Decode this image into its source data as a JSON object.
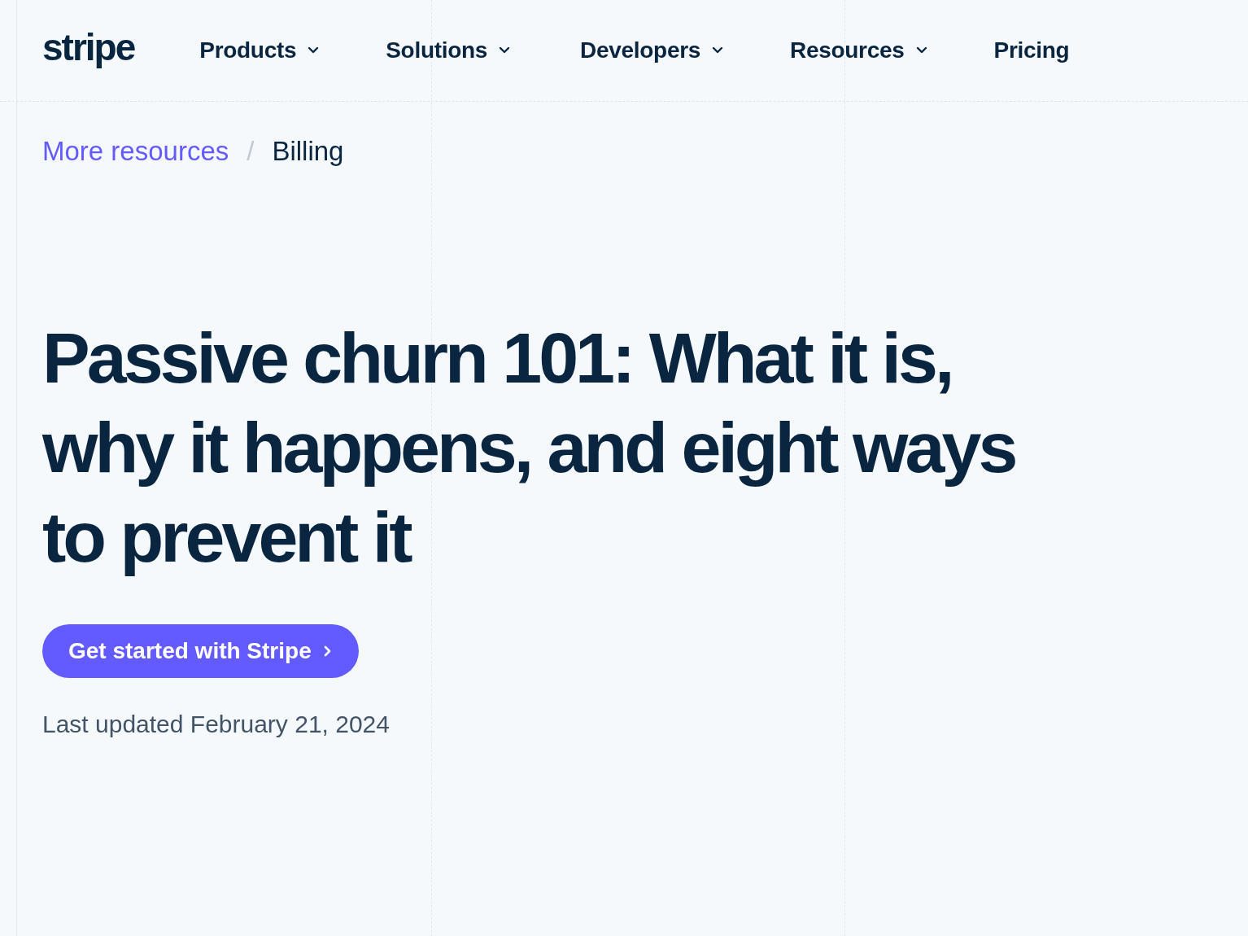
{
  "logo": "stripe",
  "nav": [
    {
      "label": "Products",
      "has_menu": true
    },
    {
      "label": "Solutions",
      "has_menu": true
    },
    {
      "label": "Developers",
      "has_menu": true
    },
    {
      "label": "Resources",
      "has_menu": true
    },
    {
      "label": "Pricing",
      "has_menu": false
    }
  ],
  "breadcrumb": {
    "parent": "More resources",
    "separator": "/",
    "current": "Billing"
  },
  "title": "Passive churn 101: What it is, why it happens, and eight ways to prevent it",
  "cta": {
    "label": "Get started with Stripe"
  },
  "updated": "Last updated February 21, 2024"
}
